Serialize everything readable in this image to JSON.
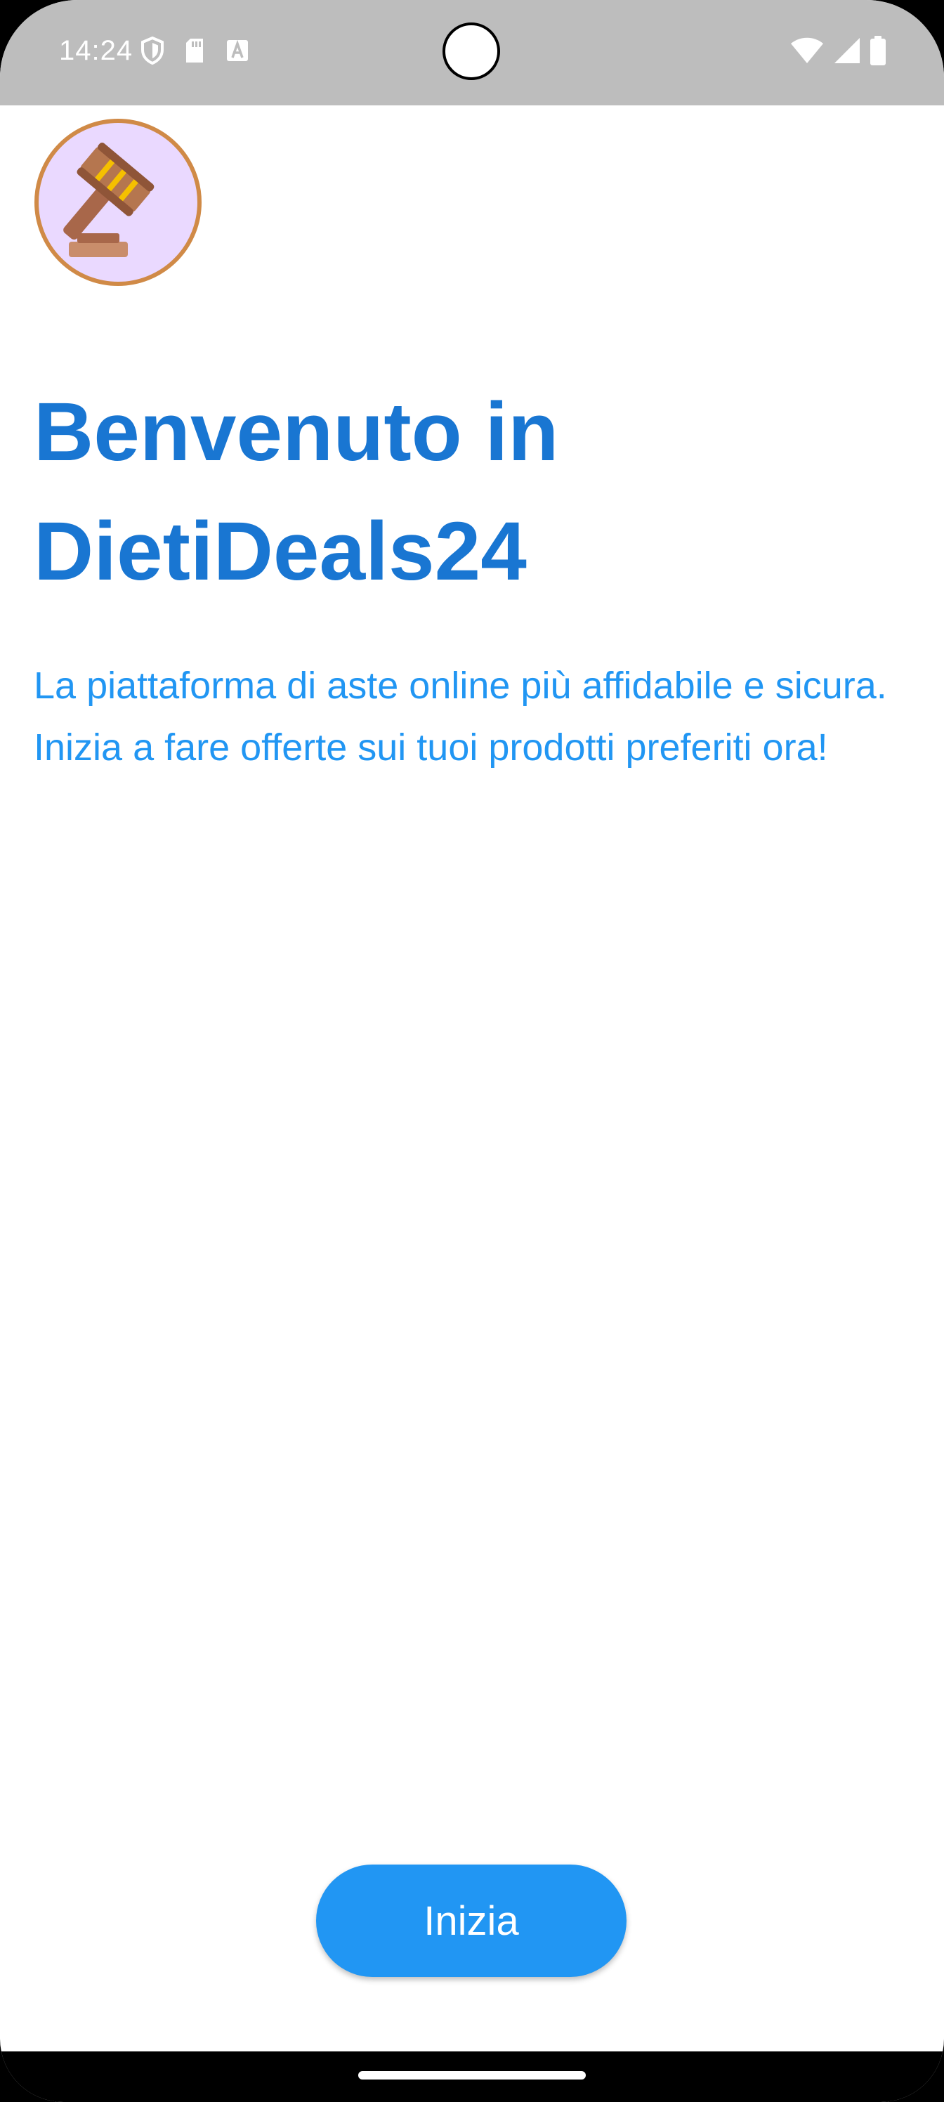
{
  "status_bar": {
    "time": "14:24",
    "left_icons": [
      "shield-icon",
      "sd-card-icon",
      "keyboard-a-icon"
    ],
    "right_icons": [
      "wifi-icon",
      "cell-signal-icon",
      "battery-icon"
    ]
  },
  "welcome": {
    "logo_icon": "gavel-icon",
    "title_line1": "Benvenuto in",
    "title_line2": "DietiDeals24",
    "subtitle": "La piattaforma di aste online più affidabile e sicura. Inizia a fare offerte sui tuoi prodotti preferiti ora!",
    "start_button_label": "Inizia"
  },
  "colors": {
    "title": "#1976d2",
    "subtitle": "#2196f3",
    "button": "#2196f3",
    "logo_background": "#ead9ff",
    "logo_border": "#d08a47",
    "status_bar": "#bdbdbd"
  }
}
